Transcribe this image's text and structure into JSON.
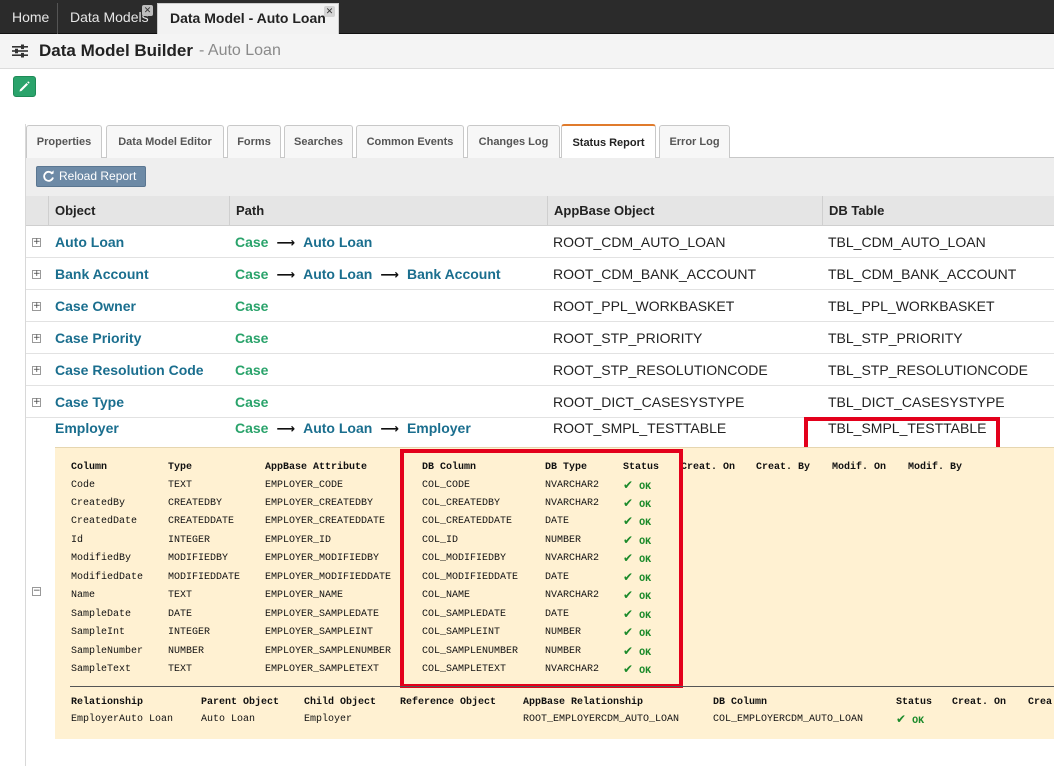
{
  "top_tabs": [
    {
      "label": "Home"
    },
    {
      "label": "Data Models"
    },
    {
      "label": "Data Model - Auto Loan"
    }
  ],
  "header": {
    "title": "Data Model Builder",
    "subtitle": "- Auto Loan"
  },
  "subtabs": [
    "Properties",
    "Data Model Editor",
    "Forms",
    "Searches",
    "Common Events",
    "Changes Log",
    "Status Report",
    "Error Log"
  ],
  "active_subtab": "Status Report",
  "toolbar": {
    "reload_label": "Reload Report"
  },
  "table": {
    "headers": [
      "Object",
      "Path",
      "AppBase Object",
      "DB Table"
    ],
    "rows": [
      {
        "object": "Auto Loan",
        "path": [
          "Case",
          "Auto Loan"
        ],
        "appbase": "ROOT_CDM_AUTO_LOAN",
        "db": "TBL_CDM_AUTO_LOAN"
      },
      {
        "object": "Bank Account",
        "path": [
          "Case",
          "Auto Loan",
          "Bank Account"
        ],
        "appbase": "ROOT_CDM_BANK_ACCOUNT",
        "db": "TBL_CDM_BANK_ACCOUNT"
      },
      {
        "object": "Case Owner",
        "path": [
          "Case"
        ],
        "appbase": "ROOT_PPL_WORKBASKET",
        "db": "TBL_PPL_WORKBASKET"
      },
      {
        "object": "Case Priority",
        "path": [
          "Case"
        ],
        "appbase": "ROOT_STP_PRIORITY",
        "db": "TBL_STP_PRIORITY"
      },
      {
        "object": "Case Resolution Code",
        "path": [
          "Case"
        ],
        "appbase": "ROOT_STP_RESOLUTIONCODE",
        "db": "TBL_STP_RESOLUTIONCODE"
      },
      {
        "object": "Case Type",
        "path": [
          "Case"
        ],
        "appbase": "ROOT_DICT_CASESYSTYPE",
        "db": "TBL_DICT_CASESYSTYPE"
      },
      {
        "object": "Employer",
        "path": [
          "Case",
          "Auto Loan",
          "Employer"
        ],
        "appbase": "ROOT_SMPL_TESTTABLE",
        "db": "TBL_SMPL_TESTTABLE"
      }
    ]
  },
  "columns_detail": {
    "headers": [
      "Column",
      "Type",
      "AppBase Attribute",
      "DB Column",
      "DB Type",
      "Status",
      "Creat. On",
      "Creat. By",
      "Modif. On",
      "Modif. By"
    ],
    "rows": [
      [
        "Code",
        "TEXT",
        "EMPLOYER_CODE",
        "COL_CODE",
        "NVARCHAR2",
        "OK"
      ],
      [
        "CreatedBy",
        "CREATEDBY",
        "EMPLOYER_CREATEDBY",
        "COL_CREATEDBY",
        "NVARCHAR2",
        "OK"
      ],
      [
        "CreatedDate",
        "CREATEDDATE",
        "EMPLOYER_CREATEDDATE",
        "COL_CREATEDDATE",
        "DATE",
        "OK"
      ],
      [
        "Id",
        "INTEGER",
        "EMPLOYER_ID",
        "COL_ID",
        "NUMBER",
        "OK"
      ],
      [
        "ModifiedBy",
        "MODIFIEDBY",
        "EMPLOYER_MODIFIEDBY",
        "COL_MODIFIEDBY",
        "NVARCHAR2",
        "OK"
      ],
      [
        "ModifiedDate",
        "MODIFIEDDATE",
        "EMPLOYER_MODIFIEDDATE",
        "COL_MODIFIEDDATE",
        "DATE",
        "OK"
      ],
      [
        "Name",
        "TEXT",
        "EMPLOYER_NAME",
        "COL_NAME",
        "NVARCHAR2",
        "OK"
      ],
      [
        "SampleDate",
        "DATE",
        "EMPLOYER_SAMPLEDATE",
        "COL_SAMPLEDATE",
        "DATE",
        "OK"
      ],
      [
        "SampleInt",
        "INTEGER",
        "EMPLOYER_SAMPLEINT",
        "COL_SAMPLEINT",
        "NUMBER",
        "OK"
      ],
      [
        "SampleNumber",
        "NUMBER",
        "EMPLOYER_SAMPLENUMBER",
        "COL_SAMPLENUMBER",
        "NUMBER",
        "OK"
      ],
      [
        "SampleText",
        "TEXT",
        "EMPLOYER_SAMPLETEXT",
        "COL_SAMPLETEXT",
        "NVARCHAR2",
        "OK"
      ]
    ]
  },
  "relationship_detail": {
    "headers": [
      "Relationship",
      "Parent Object",
      "Child Object",
      "Reference Object",
      "AppBase Relationship",
      "DB Column",
      "Status",
      "Creat. On",
      "Crea"
    ],
    "rows": [
      [
        "EmployerAuto Loan",
        "Auto Loan",
        "Employer",
        "",
        "ROOT_EMPLOYERCDM_AUTO_LOAN",
        "COL_EMPLOYERCDM_AUTO_LOAN",
        "OK"
      ]
    ]
  },
  "icons": {
    "menu": "sliders-icon",
    "edit": "pencil-icon",
    "reload": "refresh-icon",
    "status_ok": "checkmark-icon"
  },
  "colors": {
    "highlight": "#e3001b",
    "link": "#1a6e8e",
    "path_root": "#2aa36b",
    "detail_bg": "#fff1d2"
  }
}
